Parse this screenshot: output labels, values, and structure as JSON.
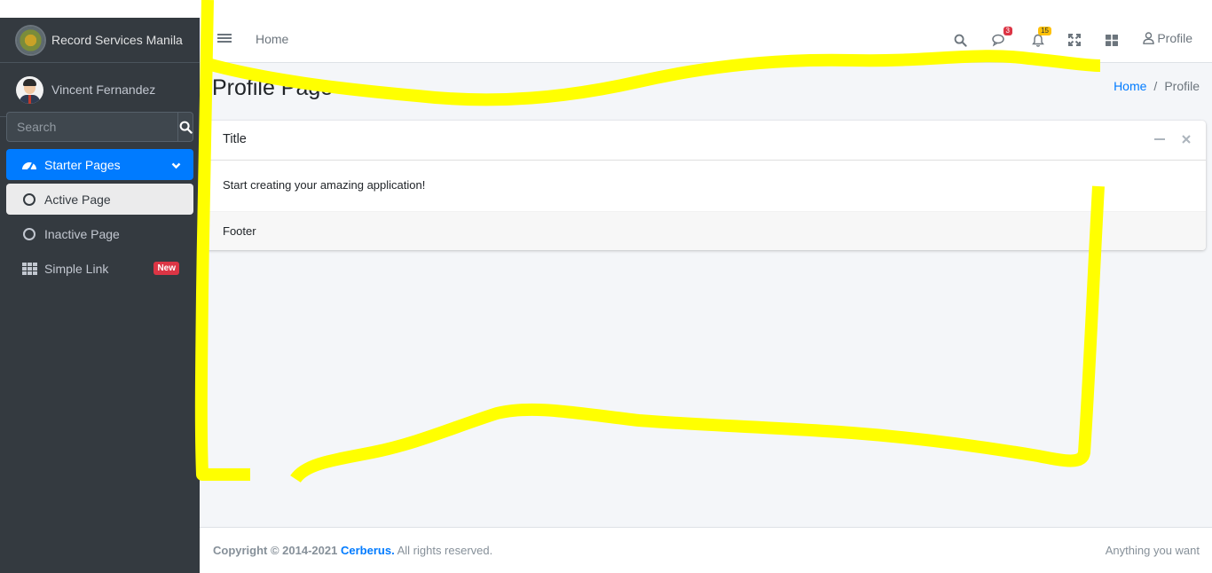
{
  "brand": {
    "name": "Record Services Manila"
  },
  "user": {
    "name": "Vincent Fernandez"
  },
  "search": {
    "placeholder": "Search"
  },
  "sidebar": {
    "items": [
      {
        "label": "Starter Pages",
        "icon": "tachometer-icon",
        "state": "expanded"
      },
      {
        "label": "Active Page",
        "icon": "circle-icon",
        "state": "active"
      },
      {
        "label": "Inactive Page",
        "icon": "circle-icon",
        "state": "normal"
      },
      {
        "label": "Simple Link",
        "icon": "grid-icon",
        "badge": "New"
      }
    ]
  },
  "topnav": {
    "home_label": "Home",
    "messages_count": "3",
    "notifications_count": "15",
    "profile_label": "Profile"
  },
  "page": {
    "title": "Profile Page",
    "breadcrumb": {
      "home": "Home",
      "separator": "/",
      "current": "Profile"
    }
  },
  "card": {
    "title": "Title",
    "body": "Start creating your amazing application!",
    "footer": "Footer"
  },
  "footer": {
    "copyright_prefix": "Copyright © 2014-2021",
    "company": "Cerberus.",
    "rights": "All rights reserved.",
    "right_text": "Anything you want"
  },
  "colors": {
    "sidebar_bg": "#343a40",
    "accent": "#007bff",
    "content_bg": "#f4f6f9",
    "badge_red": "#dc3545",
    "badge_yellow": "#ffc107",
    "annotation_highlight": "#ffff00"
  }
}
